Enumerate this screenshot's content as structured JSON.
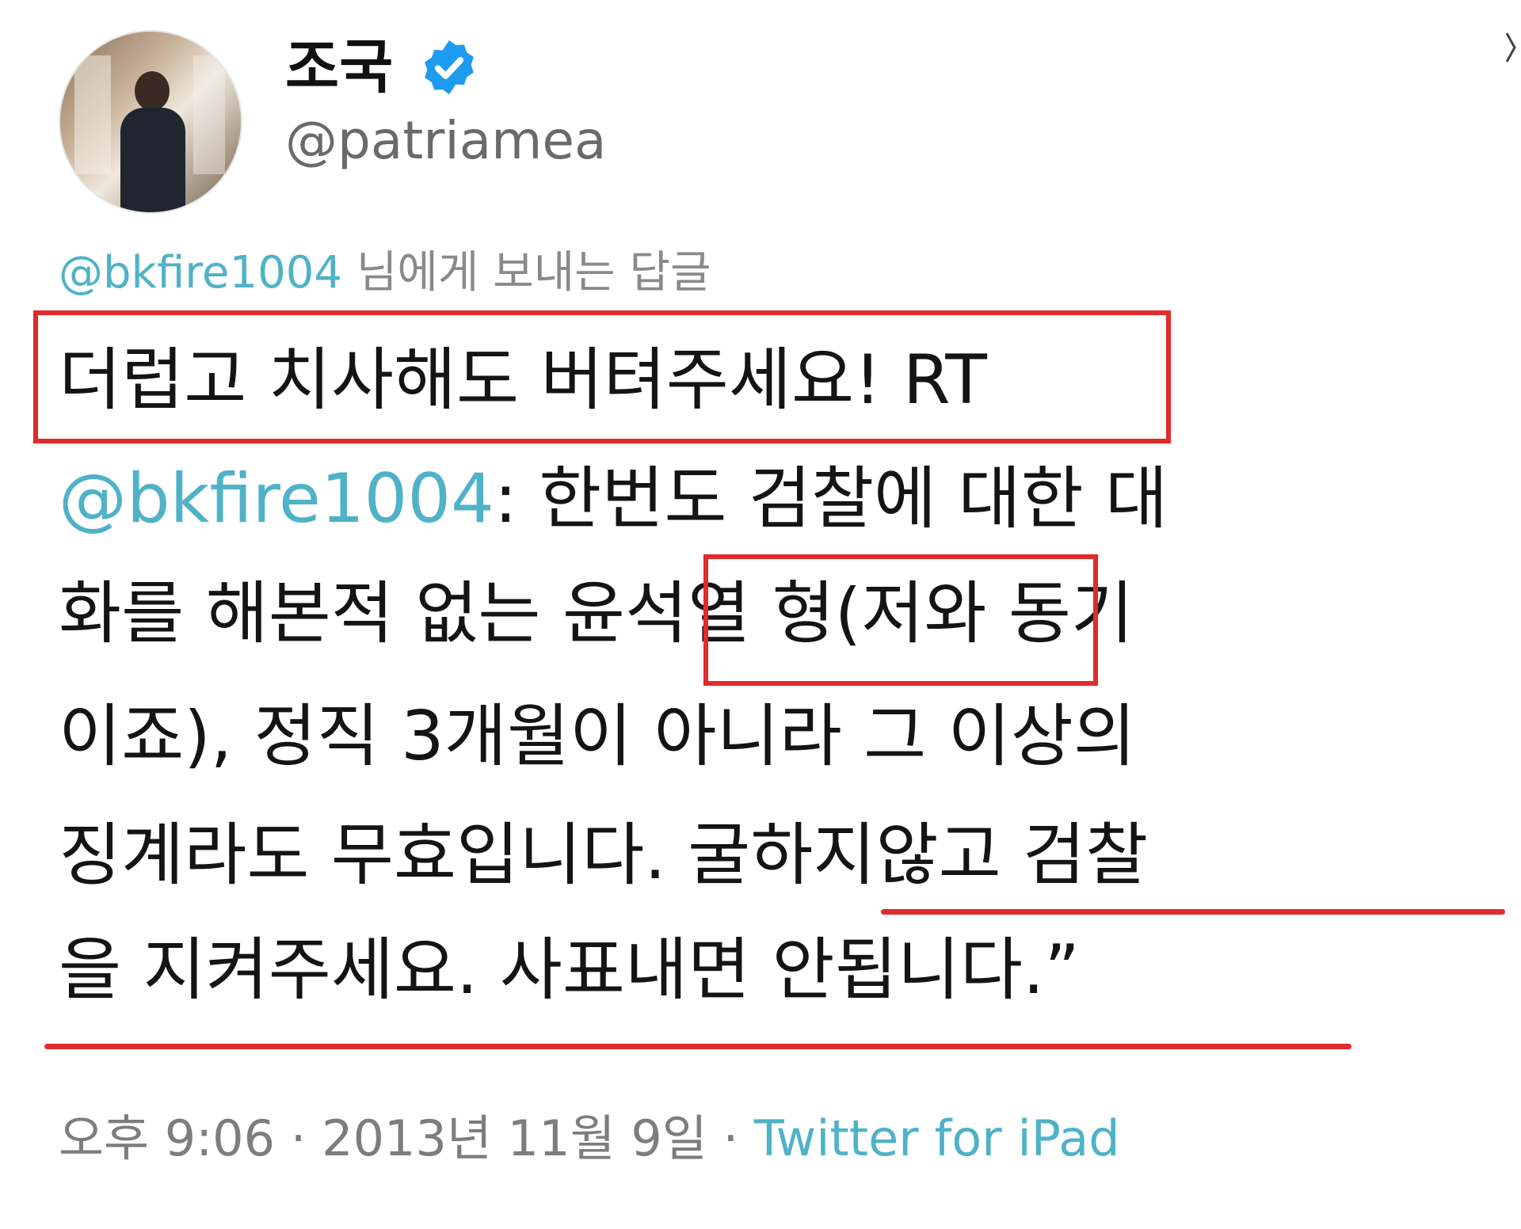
{
  "tweet": {
    "author_name": "조국",
    "author_handle": "@patriamea",
    "reply_prefix_handle": "@bkfire1004",
    "reply_suffix": "님에게 보내는 답글",
    "lines": [
      {
        "a": "더럽고 치사해도 버텨주세요!",
        "b": " RT"
      },
      {
        "a": "@bkfire1004",
        "b": ": 한번도 검찰에 대한 대"
      },
      {
        "a": "화를 해본적 없는 ",
        "b": "윤석열 형",
        "c": "(저와 동기"
      },
      {
        "a": "이죠), 정직 3개월이 아니라 그 이상의"
      },
      {
        "a": "징계라도 무효입니다. ",
        "b": "굴하지않고 검찰"
      },
      {
        "a": "을 지켜주세요. 사표내면 안됩니다.",
        "b": "”"
      }
    ],
    "time": "오후 9:06",
    "separator": " · ",
    "date": "2013년 11월 9일",
    "source": "Twitter for iPad"
  },
  "colors": {
    "highlight": "#e02b2b",
    "link": "#4fb2c8",
    "verified": "#1d9bf0"
  },
  "icons": {
    "verified": "verified-badge-icon"
  }
}
